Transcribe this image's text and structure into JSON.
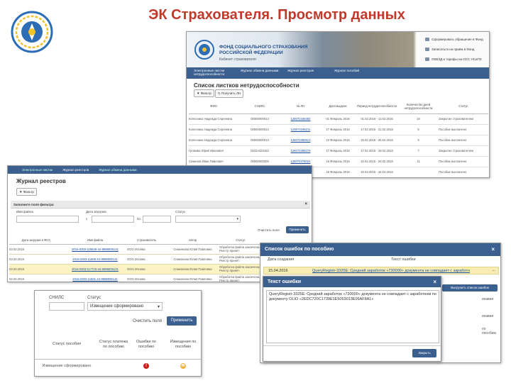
{
  "title": "ЭК Страхователя. Просмотр данных",
  "panel1": {
    "org_name": "ФОНД СОЦИАЛЬНОГО СТРАХОВАНИЯ РОССИЙСКОЙ ФЕДЕРАЦИИ",
    "org_sub": "Кабинет страхователя",
    "links": [
      "Сформировать обращение в Фонд",
      "Записаться на приём в Фонд",
      "ОКВЭД и тарифы на ОСС НСиПЗ"
    ],
    "nav": [
      "Электронные листки нетрудоспособности",
      "Журнал обмена данными",
      "Журнал реестров",
      "Журнал пособий"
    ],
    "heading": "Список листков нетрудоспособности",
    "filter_btn": "Фильтр",
    "get_btn": "Получить ЛН",
    "columns": [
      "ФИО",
      "СНИЛС",
      "№ ЛН",
      "Дата выдачи",
      "Период нетрудоспособности",
      "Количество дней нетрудоспособности",
      "Статус"
    ],
    "rows": [
      {
        "fio": "Колесника Надежда Сергеевна",
        "snils": "00000000013",
        "ln": "126072346482",
        "date": "01 Февраль 2016",
        "period": "01.02.2016 - 11.02.2016",
        "days": "10",
        "status": "Закрытие страхователем"
      },
      {
        "fio": "Колесника Надежда Сергеевна",
        "snils": "00000000013",
        "ln": "126072346211",
        "date": "17 Февраль 2016",
        "period": "17.02.2016 - 21.02.2016",
        "days": "5",
        "status": "Пособие выплачено"
      },
      {
        "fio": "Колесника Надежда Сергеевна",
        "snils": "00000000013",
        "ln": "126072350913",
        "date": "10 Февраль 2016",
        "period": "15.02.2016 - 25.02.2016",
        "days": "9",
        "status": "Пособие выплачено"
      },
      {
        "fio": "Громова Юрий Иванович",
        "snils": "02224423152",
        "ln": "126072368276",
        "date": "17 Февраль 2016",
        "period": "17.02.2016 - 19.02.2016",
        "days": "7",
        "status": "Закрытие страхователем"
      },
      {
        "fio": "Семенов Иван Павлович",
        "snils": "00000000000",
        "ln": "126072376024",
        "date": "16 Февраль 2016",
        "period": "10.02.2016 - 20.02.2016",
        "days": "11",
        "status": "Пособие выплачено"
      },
      {
        "fio": "",
        "snils": "",
        "ln": "126072376621",
        "date": "16 Февраль 2016",
        "period": "10.03.2016 - 16.03.2016",
        "days": "",
        "status": "Пособие выплачено"
      }
    ]
  },
  "panel2": {
    "nav": [
      "Электронные листки",
      "Журнал реестров",
      "Журнал обмена данными"
    ],
    "heading": "Журнал реестров",
    "filter_btn": "Фильтр",
    "fill_filter": "Заполните поля фильтра",
    "lbl_file": "Имя файла",
    "lbl_date": "Дата загрузки",
    "date_from": "с",
    "date_to": "по",
    "lbl_status": "Статус",
    "clear": "Очистить поля",
    "apply": "Применить",
    "columns": [
      "Дата загрузки в ФСС",
      "Имя файла",
      "Страхователь",
      "Автор",
      "Статус"
    ],
    "rows": [
      {
        "date": "03.03.2016",
        "file": "2016-0303-115545-44-9998005131",
        "insurer": "ООО Илоева",
        "author": "Семенкова Юлия Павловна",
        "status": "Обработка файла закончена. Реестр принят"
      },
      {
        "date": "03.03.2016",
        "file": "2016-0303-11505-44-9998005131",
        "insurer": "ООО Илоева",
        "author": "Семенкова Юлия Павловна",
        "status": "Обработка файла закончена. Реестр принят"
      },
      {
        "date": "03.03.2016",
        "file": "2016-0303-117710-44-9998005131",
        "insurer": "ООО Илоева",
        "author": "Семенкова Юлия Павловна",
        "status": "Обработка файла закончена. Реестр принят"
      },
      {
        "date": "03.03.2016",
        "file": "2016-0303-11501-44-9998005131",
        "insurer": "ООО Илоева",
        "author": "Семенкова Юлия Павловна",
        "status": "Обработка файла закончена. Реестр принят"
      }
    ]
  },
  "panel3": {
    "lbl_snils": "СНИЛС",
    "lbl_status": "Статус",
    "status_value": "Извещение сформировано",
    "clear": "Очистить поля",
    "apply": "Применить",
    "columns": [
      "Статус пособия",
      "Статус платежа по пособию",
      "Ошибки по пособию",
      "Извещения по пособию"
    ],
    "row_status": "Извещение сформировано",
    "err_glyph": "!",
    "warn_glyph": "✉"
  },
  "panel4": {
    "title": "Список ошибок по пособию",
    "col_date": "Дата создания",
    "col_text": "Текст ошибки",
    "row_date": "15.04.2016",
    "row_text": "QueryRegistr-3325E: Средний заработок «730000» документа не совпадает с заработн",
    "more": "...",
    "export": "Выгрузить список ошибок",
    "side": [
      "ихавие",
      "ихавие",
      "по пособию"
    ]
  },
  "panel5": {
    "title": "Текст ошибки",
    "text": "QueryRegistr-3325E: Средний заработок «730000» документа не совпадает с заработком по документу OLIO «2EDC720C1739E1E5053013E06AF8A1»",
    "close": "Закрыть"
  }
}
